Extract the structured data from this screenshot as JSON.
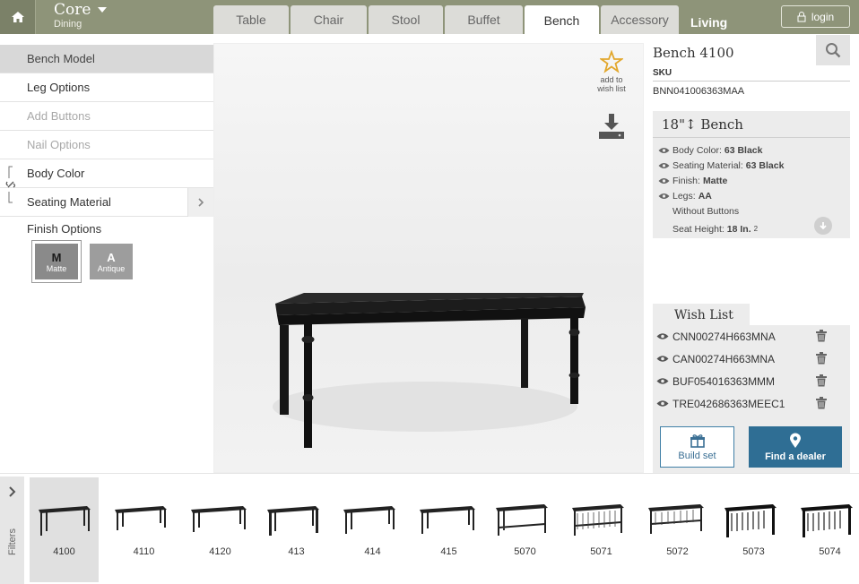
{
  "header": {
    "brand_title": "Core",
    "brand_subtitle": "Dining",
    "tabs": [
      {
        "label": "Table",
        "active": false
      },
      {
        "label": "Chair",
        "active": false
      },
      {
        "label": "Stool",
        "active": false
      },
      {
        "label": "Buffet",
        "active": false
      },
      {
        "label": "Bench",
        "active": true
      },
      {
        "label": "Accessory",
        "active": false
      }
    ],
    "living_label": "Living",
    "login_label": "login",
    "colors": {
      "bar": "#8e9479",
      "home": "#7b8168"
    }
  },
  "options": {
    "items": [
      {
        "label": "Bench Model",
        "state": "selected"
      },
      {
        "label": "Leg Options",
        "state": "normal"
      },
      {
        "label": "Add Buttons",
        "state": "disabled"
      },
      {
        "label": "Nail Options",
        "state": "disabled"
      },
      {
        "label": "Body Color",
        "state": "normal"
      },
      {
        "label": "Seating Material",
        "state": "normal"
      }
    ],
    "finish_label": "Finish Options",
    "finishes": [
      {
        "letter": "M",
        "name": "Matte",
        "selected": true
      },
      {
        "letter": "A",
        "name": "Antique",
        "selected": false
      }
    ]
  },
  "stage": {
    "wish_label_1": "add to",
    "wish_label_2": "wish list"
  },
  "product": {
    "name": "Bench 4100",
    "sku_label": "SKU",
    "sku": "BNN041006363MAA",
    "size_title": "18\"↕ Bench",
    "specs": {
      "body_color_label": "Body Color:",
      "body_color": "63 Black",
      "seating_label": "Seating Material:",
      "seating": "63 Black",
      "finish_label": "Finish:",
      "finish": "Matte",
      "legs_label": "Legs:",
      "legs": "AA",
      "buttons": "Without Buttons",
      "seat_height_label": "Seat Height:",
      "seat_height": "18 In.",
      "seat_height_note": "2"
    }
  },
  "wishlist": {
    "title": "Wish List",
    "items": [
      "CNN00274H663MNA",
      "CAN00274H663MNA",
      "BUF054016363MMM",
      "TRE042686363MEEC1"
    ],
    "build_label": "Build set",
    "dealer_label": "Find a dealer",
    "colors": {
      "dealer": "#2f6e94"
    }
  },
  "strip": {
    "filters_label": "Filters",
    "models": [
      "4100",
      "4110",
      "4120",
      "413",
      "414",
      "415",
      "5070",
      "5071",
      "5072",
      "5073",
      "5074"
    ],
    "selected": "4100"
  }
}
